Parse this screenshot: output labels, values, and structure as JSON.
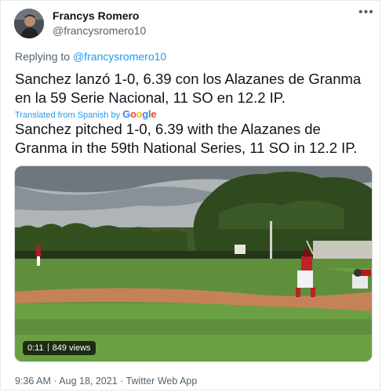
{
  "tweet": {
    "author_name": "Francys Romero",
    "author_handle": "@francysromero10",
    "more_icon": "more-icon",
    "reply_prefix": "Replying to",
    "reply_to": "@francysromero10",
    "text": "Sanchez lanzó 1-0, 6.39 con los Alazanes de Granma en la 59 Serie Nacional, 11 SO en 12.2 IP.",
    "translated_label": "Translated from Spanish by",
    "translation_provider": "Google",
    "translation": "Sanchez pitched 1-0, 6.39 with the Alazanes de Granma in the 59th National Series, 11 SO in 12.2 IP.",
    "media": {
      "duration": "0:11",
      "views": "849 views"
    },
    "timestamp": "9:36 AM · Aug 18, 2021 · Twitter Web App"
  }
}
